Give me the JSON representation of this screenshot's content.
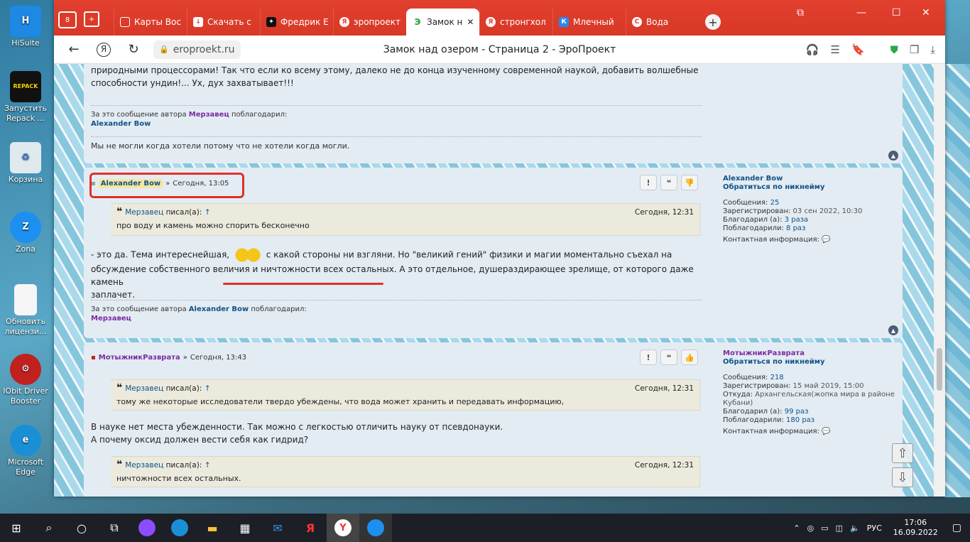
{
  "desktop": {
    "icons": [
      {
        "label": "HiSuite",
        "icon": "hisuite-icon",
        "color": "#1e88e5"
      },
      {
        "label": "Запустить Repack ...",
        "icon": "repack-icon",
        "color": "#f5d300"
      },
      {
        "label": "Корзина",
        "icon": "recycle-bin-icon",
        "color": "#dfe9ee"
      },
      {
        "label": "Zona",
        "icon": "zona-icon",
        "color": "#1d8ff0"
      },
      {
        "label": "Обновить лицензи...",
        "icon": "document-icon",
        "color": "#f5f5f5"
      },
      {
        "label": "IObit Driver Booster",
        "icon": "driver-booster-icon",
        "color": "#c0201e"
      },
      {
        "label": "Microsoft Edge",
        "icon": "edge-icon",
        "color": "#1a8fd6"
      }
    ]
  },
  "browser": {
    "tabs": [
      {
        "label": "Карты Вос",
        "icon": "page-icon",
        "color": "transparent"
      },
      {
        "label": "Скачать с",
        "icon": "download-tab-icon",
        "color": "#e33"
      },
      {
        "label": "Фредрик Е",
        "icon": "star-tab-icon",
        "color": "#111"
      },
      {
        "label": "эропроект",
        "icon": "yandex-tab-icon",
        "color": "#f33"
      },
      {
        "label": "Замок н",
        "icon": "site-tab-icon",
        "color": "#2a9d3b",
        "active": true
      },
      {
        "label": "стронгхол",
        "icon": "yandex-tab-icon",
        "color": "#f33"
      },
      {
        "label": "Млечный",
        "icon": "vk-tab-icon",
        "color": "#2787f5"
      },
      {
        "label": "Вода",
        "icon": "c-tab-icon",
        "color": "#e33"
      }
    ],
    "address": "eroproekt.ru",
    "page_title": "Замок над озером - Страница 2 - ЭроПроект"
  },
  "top_post": {
    "text_line1": "природными процессорами! Так что если ко всему этому, далеко не до конца изученному современной наукой, добавить волшебные",
    "text_line2": "способности ундин!... Ух, дух захватывает!!!",
    "thanks_prefix": "За это сообщение автора",
    "thanks_author": "Мерзавец",
    "thanks_suffix": "поблагодарил:",
    "thanked_by": "Alexander Bow",
    "signature": "Мы не могли когда хотели потому что не хотели когда могли."
  },
  "post1": {
    "author": "Alexander Bow",
    "time": "Сегодня, 13:05",
    "quote_author": "Мерзавец",
    "quote_wrote": "писал(а):",
    "quote_time": "Сегодня, 12:31",
    "quote_text": "про воду и камень можно спорить бесконечно",
    "text_a": "- это да. Тема интереснейшая,",
    "text_b": "с какой стороны ни взгляни. Но \"великий гений\" физики и магии моментально съехал на",
    "text_line2": "обсуждение собственного величия и ничтожности всех остальных. А это отдельное, душераздирающее зрелище, от которого даже камень",
    "text_line3": "заплачет.",
    "thanks_prefix": "За это сообщение автора",
    "thanks_author": "Alexander Bow",
    "thanks_suffix": "поблагодарил:",
    "thanked_by": "Мерзавец",
    "profile": {
      "name": "Alexander Bow",
      "contact_nick": "Обратиться по никнейму",
      "posts_label": "Сообщения:",
      "posts": "25",
      "reg_label": "Зарегистрирован:",
      "reg": "03 сен 2022, 10:30",
      "thanked_label": "Благодарил (а):",
      "thanked": "3 раза",
      "thanks_got_label": "Поблагодарили:",
      "thanks_got": "8 раз",
      "contact_label": "Контактная информация:"
    }
  },
  "post2": {
    "author": "МотыжникРазврата",
    "time": "Сегодня, 13:43",
    "quote1_author": "Мерзавец",
    "quote1_wrote": "писал(а):",
    "quote1_time": "Сегодня, 12:31",
    "quote1_text": "тому же некоторые исследователи твердо убеждены, что вода может хранить и передавать информацию,",
    "text_line1": "В науке нет места убежденности. Так можно с легкостью отличить науку от псевдонауки.",
    "text_line2": "А почему оксид должен вести себя как гидрид?",
    "quote2_author": "Мерзавец",
    "quote2_wrote": "писал(а):",
    "quote2_time": "Сегодня, 12:31",
    "quote2_text": "ничтожности всех остальных.",
    "profile": {
      "name": "МотыжникРазврата",
      "contact_nick": "Обратиться по никнейму",
      "posts_label": "Сообщения:",
      "posts": "218",
      "reg_label": "Зарегистрирован:",
      "reg": "15 май 2019, 15:00",
      "from_label": "Откуда:",
      "from": "Архангельская(жопка мира в районе Кубани)",
      "thanked_label": "Благодарил (а):",
      "thanked": "99 раз",
      "thanks_got_label": "Поблагодарили:",
      "thanks_got": "180 раз",
      "contact_label": "Контактная информация:"
    }
  },
  "taskbar": {
    "lang": "РУС",
    "time": "17:06",
    "date": "16.09.2022"
  },
  "colors": {
    "accent": "#e0302a",
    "link": "#105289",
    "purple": "#7b2ba0"
  }
}
